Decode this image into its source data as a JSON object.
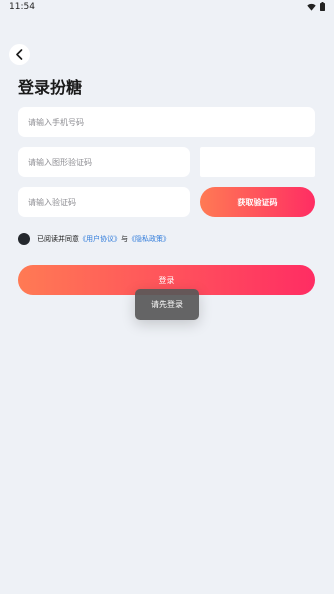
{
  "status_bar": {
    "time": "11:54",
    "icons": [
      "wifi-icon",
      "battery-icon"
    ]
  },
  "header": {
    "back_icon": "chevron-left-icon",
    "title": "登录扮糖"
  },
  "form": {
    "phone": {
      "value": "",
      "placeholder": "请输入手机号码"
    },
    "captcha": {
      "value": "",
      "placeholder": "请输入图形验证码"
    },
    "sms_code": {
      "value": "",
      "placeholder": "请输入验证码"
    },
    "get_code_label": "获取验证码"
  },
  "agreement": {
    "prefix": "已阅读并同意",
    "user_agreement": "《用户协议》",
    "joiner": "与",
    "privacy_policy": "《隐私政策》"
  },
  "login_label": "登录",
  "toast": "请先登录",
  "colors": {
    "background": "#eef1f6",
    "gradient_start": "#ff7a54",
    "gradient_end": "#ff2d63",
    "link": "#2f7bdb",
    "checkbox": "#24282d",
    "toast_bg": "#585858"
  }
}
